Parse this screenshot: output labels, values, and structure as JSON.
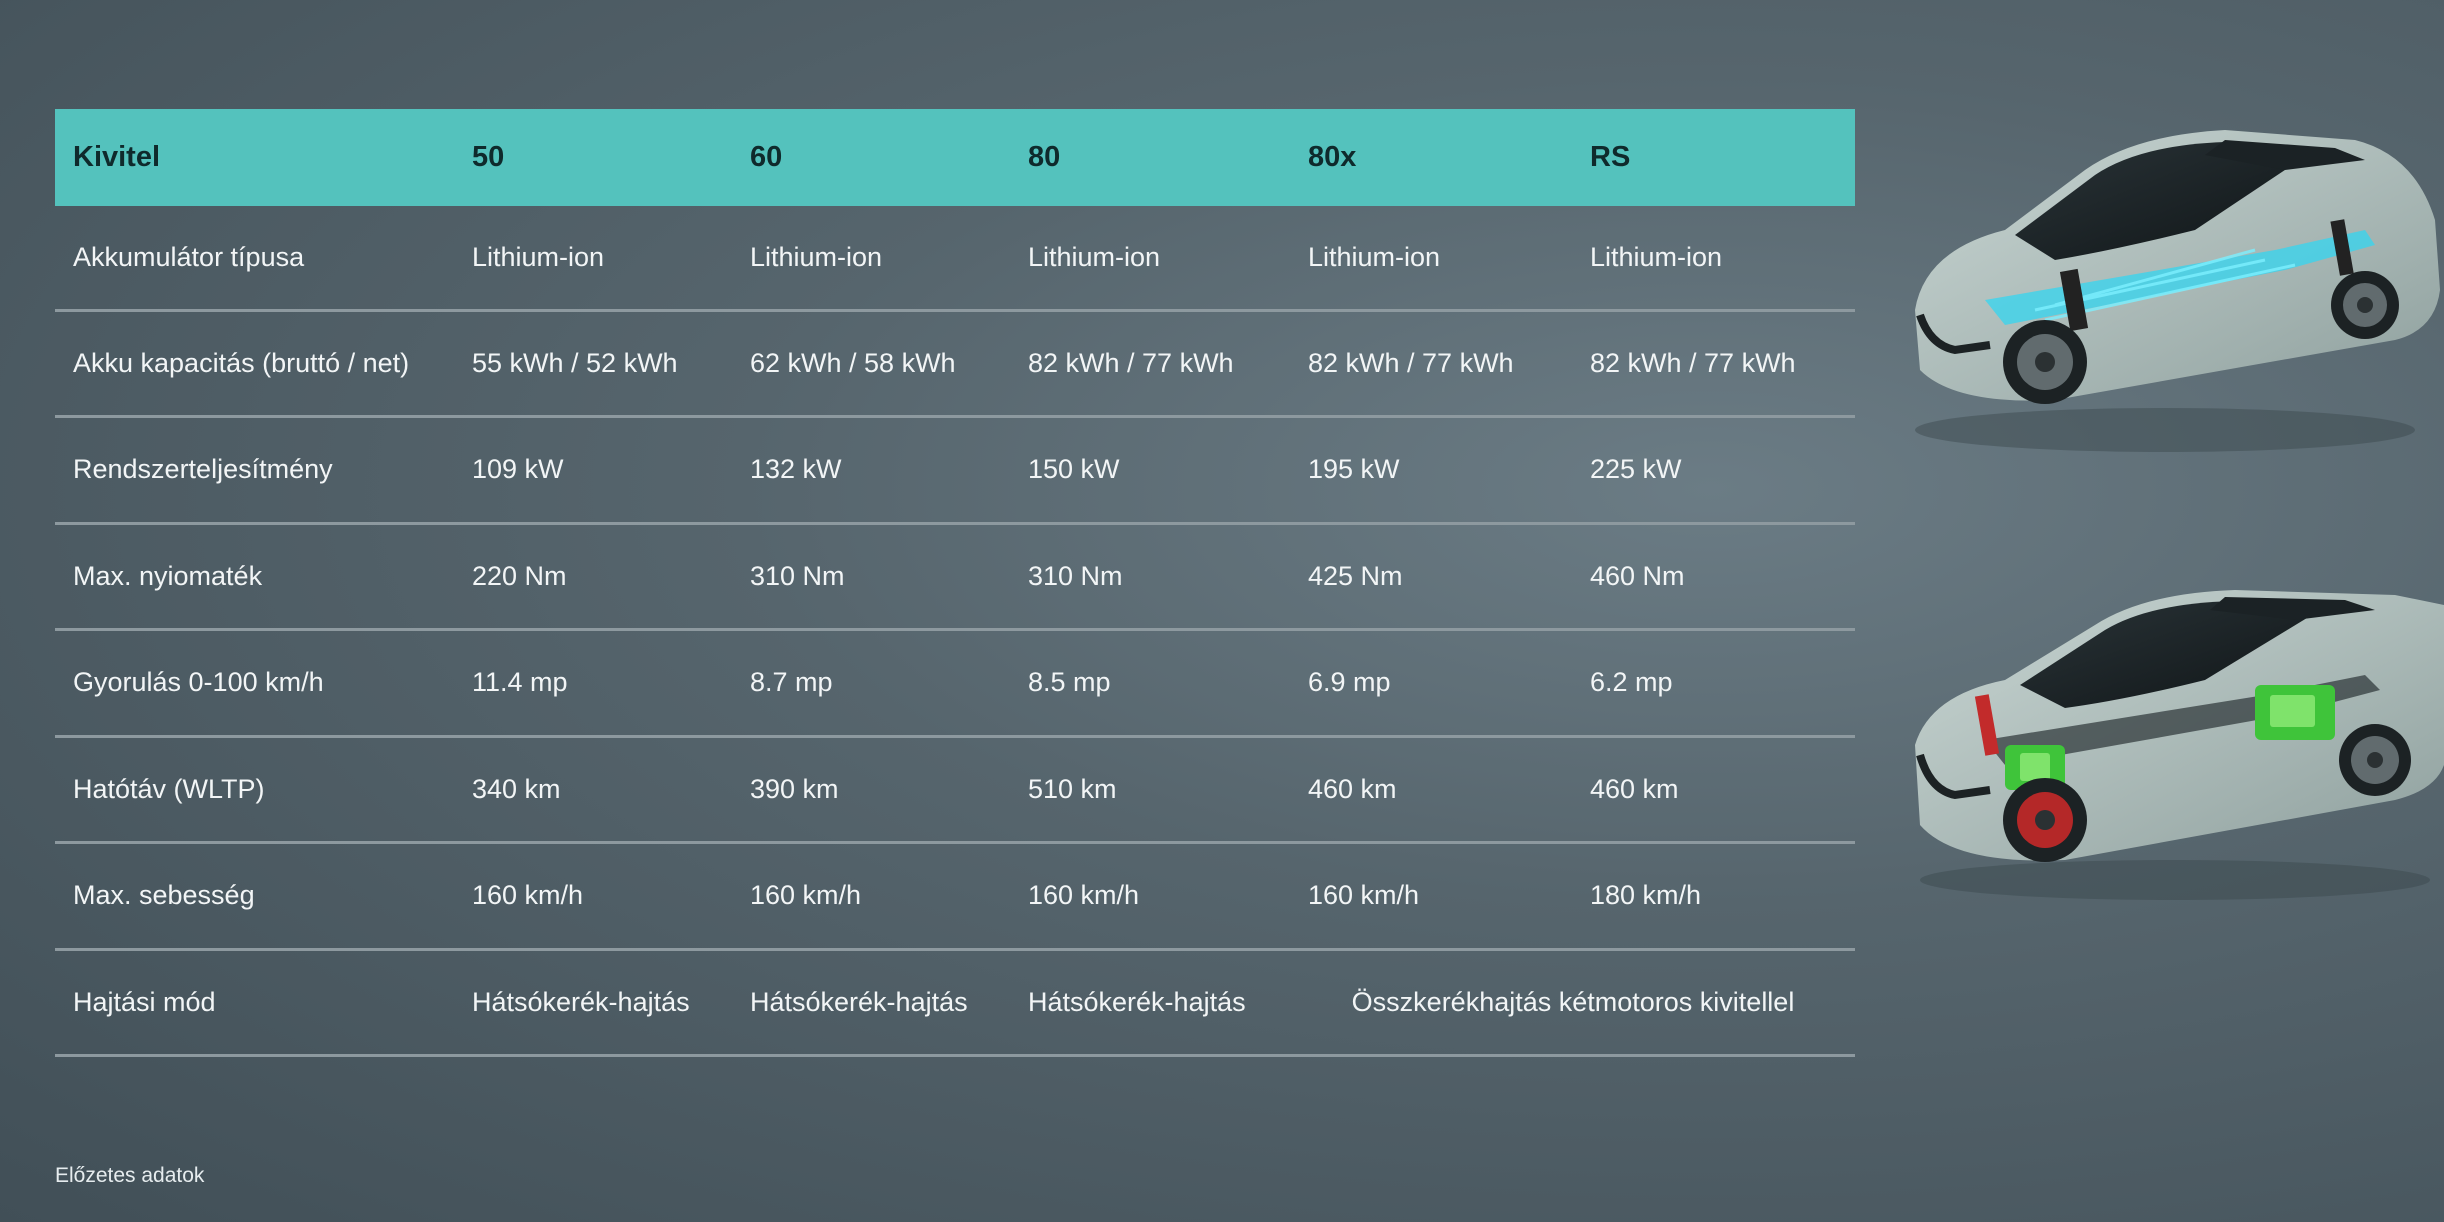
{
  "table": {
    "header": [
      "Kivitel",
      "50",
      "60",
      "80",
      "80x",
      "RS"
    ],
    "rows": [
      {
        "label": "Akkumulátor típusa",
        "values": [
          "Lithium-ion",
          "Lithium-ion",
          "Lithium-ion",
          "Lithium-ion",
          "Lithium-ion"
        ]
      },
      {
        "label": "Akku kapacitás (bruttó / net)",
        "values": [
          "55 kWh / 52 kWh",
          "62 kWh / 58 kWh",
          "82 kWh / 77 kWh",
          "82 kWh / 77 kWh",
          "82 kWh / 77 kWh"
        ]
      },
      {
        "label": "Rendszerteljesítmény",
        "values": [
          "109 kW",
          "132 kW",
          "150 kW",
          "195 kW",
          "225 kW"
        ]
      },
      {
        "label": "Max. nyiomaték",
        "values": [
          "220 Nm",
          "310 Nm",
          "310 Nm",
          "425 Nm",
          "460 Nm"
        ]
      },
      {
        "label": "Gyorulás 0-100 km/h",
        "values": [
          "11.4 mp",
          "8.7 mp",
          "8.5 mp",
          "6.9 mp",
          "6.2 mp"
        ]
      },
      {
        "label": "Hatótáv (WLTP)",
        "values": [
          "340 km",
          "390 km",
          "510 km",
          "460 km",
          "460 km"
        ]
      },
      {
        "label": "Max. sebesség",
        "values": [
          "160 km/h",
          "160 km/h",
          "160 km/h",
          "160 km/h",
          "180 km/h"
        ]
      },
      {
        "label": "Hajtási mód",
        "values": [
          "Hátsókerék-hajtás",
          "Hátsókerék-hajtás",
          "Hátsókerék-hajtás"
        ],
        "merged": "Összkerékhajtás kétmotoros kivitellel"
      }
    ]
  },
  "footnote": "Előzetes adatok",
  "images": {
    "top": "car-cutaway-battery-image",
    "bottom": "car-cutaway-drivetrain-image"
  },
  "colors": {
    "header_bg": "#54c2bd",
    "header_text": "#0f2a2c",
    "row_divider": "#8d999f",
    "background": "#56656d"
  }
}
